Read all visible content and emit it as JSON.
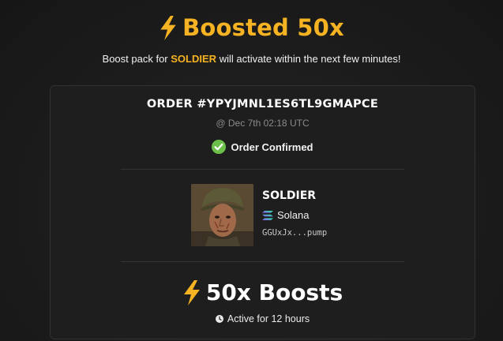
{
  "header": {
    "title": "Boosted 50x",
    "subtitle_prefix": "Boost pack for",
    "subtitle_token": "SOLDIER",
    "subtitle_suffix": "will activate within the next few minutes!"
  },
  "order": {
    "id_label": "ORDER #YPYJMNL1ES6TL9GMAPCE",
    "time": "@ Dec 7th 02:18 UTC",
    "status": "Order Confirmed"
  },
  "token": {
    "name": "SOLDIER",
    "chain": "Solana",
    "address": "GGUxJx...pump"
  },
  "boost": {
    "label": "50x Boosts",
    "duration": "Active for 12 hours"
  },
  "colors": {
    "accent": "#f5b222",
    "success": "#6cbf4a",
    "background": "#1c1c1c",
    "card": "#1e1e1e"
  },
  "icons": [
    "lightning-bolt-icon",
    "check-circle-icon",
    "solana-icon",
    "clock-icon"
  ]
}
